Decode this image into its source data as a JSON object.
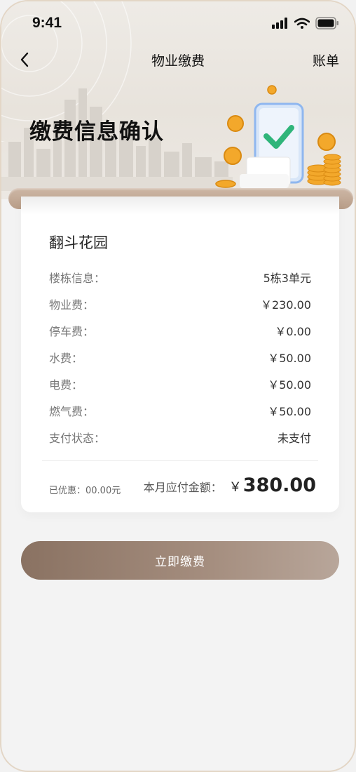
{
  "status_bar": {
    "time": "9:41"
  },
  "nav": {
    "title": "物业缴费",
    "right_label": "账单"
  },
  "hero": {
    "headline": "缴费信息确认"
  },
  "bill": {
    "community": "翻斗花园",
    "rows": [
      {
        "label": "楼栋信息：",
        "value": "5栋3单元"
      },
      {
        "label": "物业费：",
        "value": "￥230.00"
      },
      {
        "label": "停车费：",
        "value": "￥0.00"
      },
      {
        "label": "水费：",
        "value": "￥50.00"
      },
      {
        "label": "电费：",
        "value": "￥50.00"
      },
      {
        "label": "燃气费：",
        "value": "￥50.00"
      },
      {
        "label": "支付状态：",
        "value": "未支付"
      }
    ],
    "discount": "已优惠：00.00元",
    "total_label": "本月应付金额：",
    "total_currency": "￥",
    "total_amount": "380.00"
  },
  "actions": {
    "pay_label": "立即缴费"
  },
  "colors": {
    "accent": "#8a7262",
    "check": "#2fb57a",
    "coin": "#f3a82b"
  }
}
